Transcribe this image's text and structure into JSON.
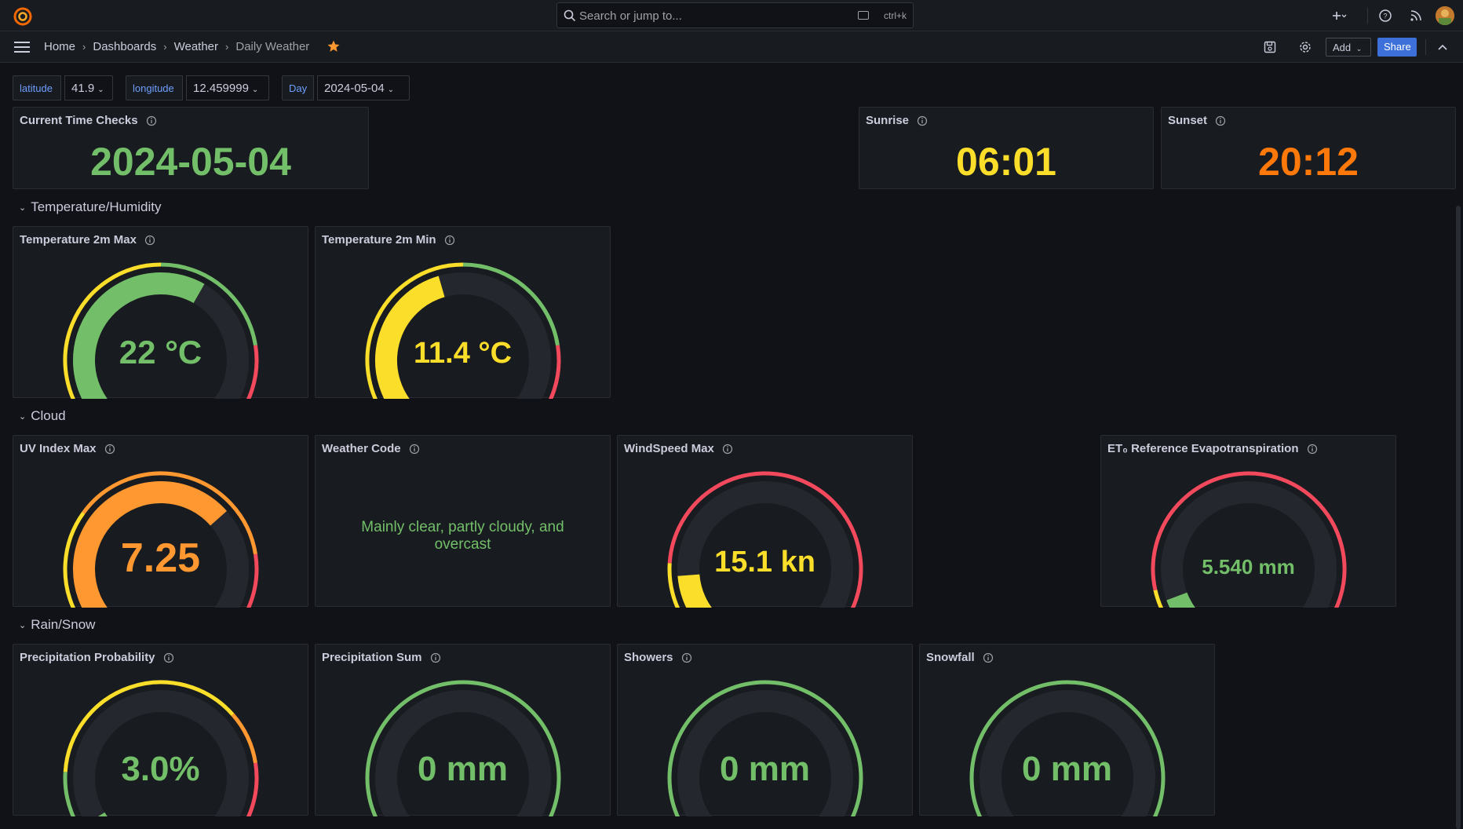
{
  "search": {
    "placeholder": "Search or jump to...",
    "shortcut": "ctrl+k"
  },
  "breadcrumbs": [
    "Home",
    "Dashboards",
    "Weather",
    "Daily Weather"
  ],
  "toolbar": {
    "add_label": "Add",
    "share_label": "Share"
  },
  "variables": [
    {
      "label": "latitude",
      "value": "41.9"
    },
    {
      "label": "longitude",
      "value": "12.459999"
    },
    {
      "label": "Day",
      "value": "2024-05-04"
    }
  ],
  "colors": {
    "green": "#73bf69",
    "yellow": "#fade2a",
    "orange": "#ff9830",
    "red": "#f2495c",
    "dark_orange": "#ff780a",
    "track": "#25272e",
    "accent": "#3d71d9"
  },
  "panels": {
    "current_time": {
      "title": "Current Time Checks",
      "value": "2024-05-04"
    },
    "sunrise": {
      "title": "Sunrise",
      "value": "06:01"
    },
    "sunset": {
      "title": "Sunset",
      "value": "20:12"
    },
    "temp_max": {
      "title": "Temperature 2m Max",
      "value": "22 °C",
      "fill": 0.61
    },
    "temp_min": {
      "title": "Temperature 2m Min",
      "value": "11.4 °C",
      "fill": 0.44
    },
    "uv_index": {
      "title": "UV Index Max",
      "value": "7.25",
      "fill": 0.68
    },
    "weather_code": {
      "title": "Weather Code",
      "value": "Mainly clear, partly cloudy, and overcast"
    },
    "windspeed": {
      "title": "WindSpeed Max",
      "value": "15.1 kn",
      "fill": 0.15
    },
    "et0": {
      "title": "ET₀ Reference Evapotranspiration",
      "value": "5.540 mm",
      "fill": 0.09
    },
    "precip_prob": {
      "title": "Precipitation Probability",
      "value": "3.0%",
      "fill": 0.05
    },
    "precip_sum": {
      "title": "Precipitation Sum",
      "value": "0 mm",
      "fill": 0
    },
    "showers": {
      "title": "Showers",
      "value": "0 mm",
      "fill": 0
    },
    "snowfall": {
      "title": "Snowfall",
      "value": "0 mm",
      "fill": 0
    }
  },
  "rows": {
    "temperature": "Temperature/Humidity",
    "cloud": "Cloud",
    "rain": "Rain/Snow"
  }
}
